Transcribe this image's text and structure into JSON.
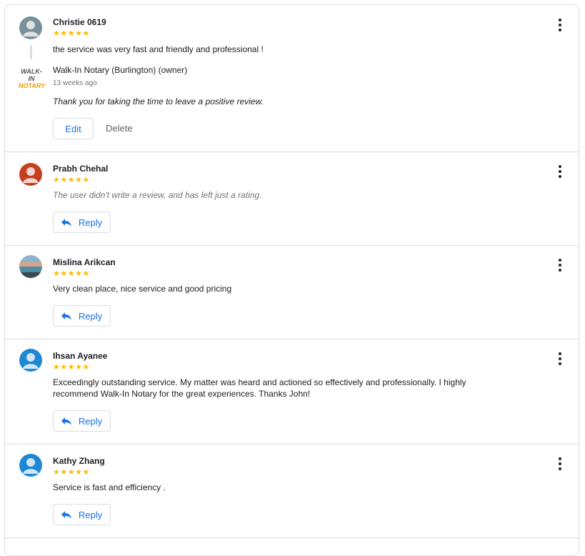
{
  "reviews": [
    {
      "name": "Christie 0619",
      "stars": "★★★★★",
      "text": "the service was very fast and friendly and professional !",
      "avatar_color": "#78909c",
      "owner": {
        "name": "Walk-In Notary (Burlington) (owner)",
        "time": "13 weeks ago",
        "reply": "Thank you for taking the time to leave a positive review.",
        "logo_line1": "WALK-IN",
        "logo_line2": "NOTARY"
      },
      "edit_label": "Edit",
      "delete_label": "Delete"
    },
    {
      "name": "Prabh Chehal",
      "stars": "★★★★★",
      "text": "The user didn't write a review, and has left just a rating.",
      "avatar_color": "#c5401f",
      "reply_label": "Reply"
    },
    {
      "name": "Mislina Arikcan",
      "stars": "★★★★★",
      "text": "Very clean place, nice service and good pricing",
      "reply_label": "Reply"
    },
    {
      "name": "Ihsan Ayanee",
      "stars": "★★★★★",
      "text": "Exceedingly outstanding service. My matter was heard and actioned so effectively and professionally. I highly recommend Walk-In Notary for the great experiences. Thanks John!",
      "avatar_color": "#1e88d6",
      "reply_label": "Reply"
    },
    {
      "name": "Kathy Zhang",
      "stars": "★★★★★",
      "text": "Service is fast and efficiency .",
      "avatar_color": "#1e88d6",
      "reply_label": "Reply"
    }
  ],
  "colors": {
    "star": "#fbbc04",
    "accent": "#1a73e8",
    "border": "#dadce0"
  },
  "icons": {
    "menu": "more-vert-icon",
    "reply": "reply-arrow-icon",
    "avatar": "person-icon"
  }
}
